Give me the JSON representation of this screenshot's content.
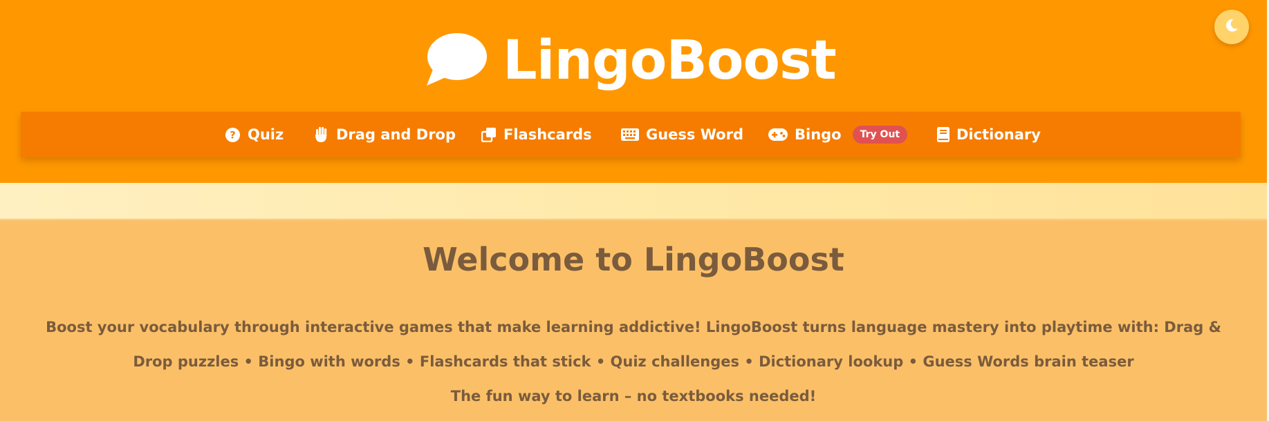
{
  "app": {
    "brand_name": "LingoBoost",
    "logo_icon": "speech-bubble-icon",
    "theme_toggle_icon": "moon-icon",
    "colors": {
      "header_bg": "#ff9800",
      "nav_bg": "#f57c00",
      "badge_bg": "#e05252",
      "content_bg": "#fbc067",
      "text_brown": "#7a5b3d"
    }
  },
  "nav": {
    "items": [
      {
        "label": "Quiz",
        "icon": "question-circle-icon"
      },
      {
        "label": "Drag and Drop",
        "icon": "hand-icon"
      },
      {
        "label": "Flashcards",
        "icon": "clone-icon"
      },
      {
        "label": "Guess Word",
        "icon": "keyboard-icon"
      },
      {
        "label": "Bingo",
        "icon": "gamepad-icon",
        "badge": "Try Out"
      },
      {
        "label": "Dictionary",
        "icon": "book-icon"
      }
    ]
  },
  "welcome": {
    "title": "Welcome to LingoBoost",
    "body": "Boost your vocabulary through interactive games that make learning addictive! LingoBoost turns language mastery into playtime with: Drag & Drop puzzles • Bingo with words • Flashcards that stick • Quiz challenges • Dictionary lookup • Guess Words brain teaser",
    "tagline": "The fun way to learn – no textbooks needed!"
  }
}
